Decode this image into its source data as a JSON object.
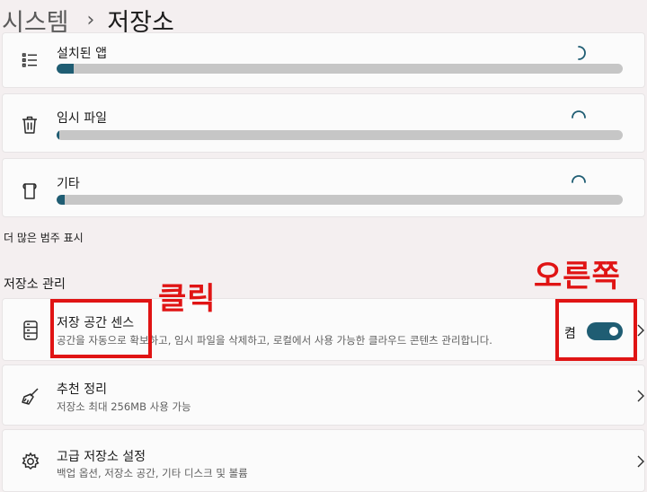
{
  "breadcrumb": {
    "parent": "시스템",
    "separator": "›",
    "current": "저장소"
  },
  "usage_items": [
    {
      "label": "설치된 앱",
      "icon": "list-icon",
      "fill_fraction": 0.03
    },
    {
      "label": "임시 파일",
      "icon": "trash-icon",
      "fill_fraction": 0.005
    },
    {
      "label": "기타",
      "icon": "file-icon",
      "fill_fraction": 0.015
    }
  ],
  "more_categories_link": "더 많은 범주 표시",
  "storage_management": {
    "section_title": "저장소 관리",
    "storage_sense": {
      "title": "저장 공간 센스",
      "description": "공간을 자동으로 확보하고, 임시 파일을 삭제하고, 로컬에서 사용 가능한 클라우드 콘텐츠 관리합니다.",
      "toggle_label": "켬",
      "toggle_on": true
    },
    "cleanup": {
      "title": "추천 정리",
      "description": "저장소 최대 256MB 사용 가능"
    },
    "advanced": {
      "title": "고급 저장소 설정",
      "description": "백업 옵션, 저장소 공간, 기타 디스크 및 볼륨"
    }
  },
  "annotations": {
    "click_label": "클릭",
    "right_label": "오른쪽"
  },
  "colors": {
    "accent": "#1f5d73",
    "annotation": "#e01414",
    "bar_track": "#c6c6c6"
  }
}
